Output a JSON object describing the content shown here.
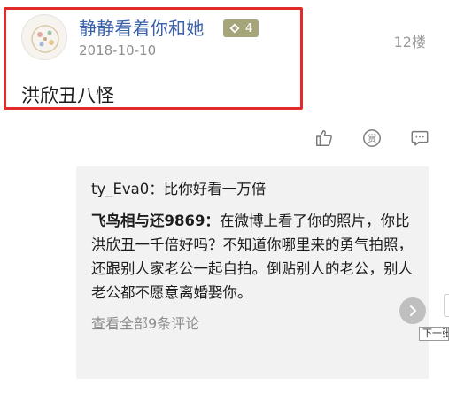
{
  "comment": {
    "username": "静静看着你和她",
    "level": "4",
    "date": "2018-10-10",
    "floor": "12楼",
    "text": "洪欣丑八怪"
  },
  "actions": {
    "like_icon": "thumbs-up-icon",
    "reward_icon": "reward-icon",
    "reward_label": "赏",
    "reply_icon": "chat-bubble-icon"
  },
  "replies": [
    {
      "author": "ty_Eva0：",
      "text": "比你好看一万倍"
    },
    {
      "author": "飞鸟相与还9869：",
      "text": "在微博上看了你的照片，你比洪欣丑一千倍好吗？不知道你哪里来的勇气拍照，还跟别人家老公一起自拍。倒贴别人的老公，别人老公都不愿意离婚娶你。"
    }
  ],
  "view_all": "查看全部9条评论",
  "next_tooltip": "下一张",
  "colors": {
    "username": "#3b61a8",
    "highlight": "#e12a2a",
    "badge": "#a6a57a",
    "reply_bg": "#f2f2f2"
  }
}
